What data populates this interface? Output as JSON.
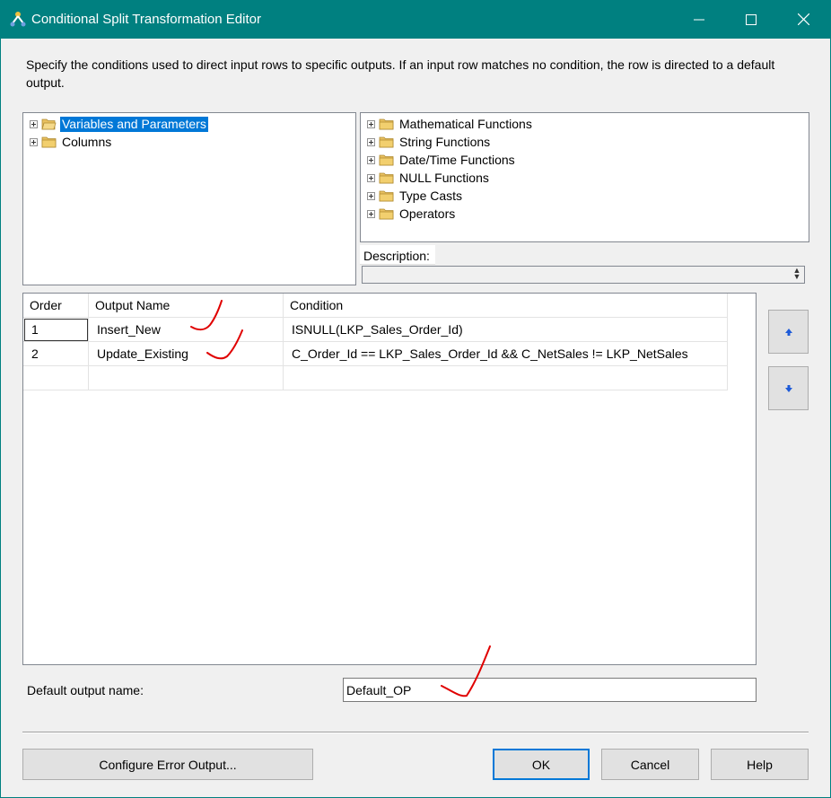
{
  "window": {
    "title": "Conditional Split Transformation Editor"
  },
  "instructions": "Specify the conditions used to direct input rows to specific outputs. If an input row matches no condition, the row is directed to a default output.",
  "left_tree": {
    "items": [
      {
        "label": "Variables and Parameters",
        "selected": true
      },
      {
        "label": "Columns",
        "selected": false
      }
    ]
  },
  "right_tree": {
    "items": [
      {
        "label": "Mathematical Functions"
      },
      {
        "label": "String Functions"
      },
      {
        "label": "Date/Time Functions"
      },
      {
        "label": "NULL Functions"
      },
      {
        "label": "Type Casts"
      },
      {
        "label": "Operators"
      }
    ]
  },
  "description": {
    "label": "Description:",
    "value": ""
  },
  "grid": {
    "headers": [
      "Order",
      "Output Name",
      "Condition"
    ],
    "rows": [
      {
        "order": "1",
        "output_name": "Insert_New",
        "condition": "ISNULL(LKP_Sales_Order_Id)"
      },
      {
        "order": "2",
        "output_name": "Update_Existing",
        "condition": "C_Order_Id == LKP_Sales_Order_Id && C_NetSales != LKP_NetSales"
      }
    ]
  },
  "default_output": {
    "label": "Default output name:",
    "value": "Default_OP"
  },
  "buttons": {
    "configure": "Configure Error Output...",
    "ok": "OK",
    "cancel": "Cancel",
    "help": "Help"
  },
  "colors": {
    "title_bar": "#008080",
    "selection": "#0078d7",
    "annotation": "#e00000",
    "folder": "#e8c060"
  },
  "icons": {
    "app": "conditional-split-icon",
    "minimize": "minimize-icon",
    "maximize": "maximize-icon",
    "close": "close-icon",
    "folder": "folder-icon",
    "expand": "plus-expander-icon",
    "move_up": "arrow-up-icon",
    "move_down": "arrow-down-icon"
  }
}
